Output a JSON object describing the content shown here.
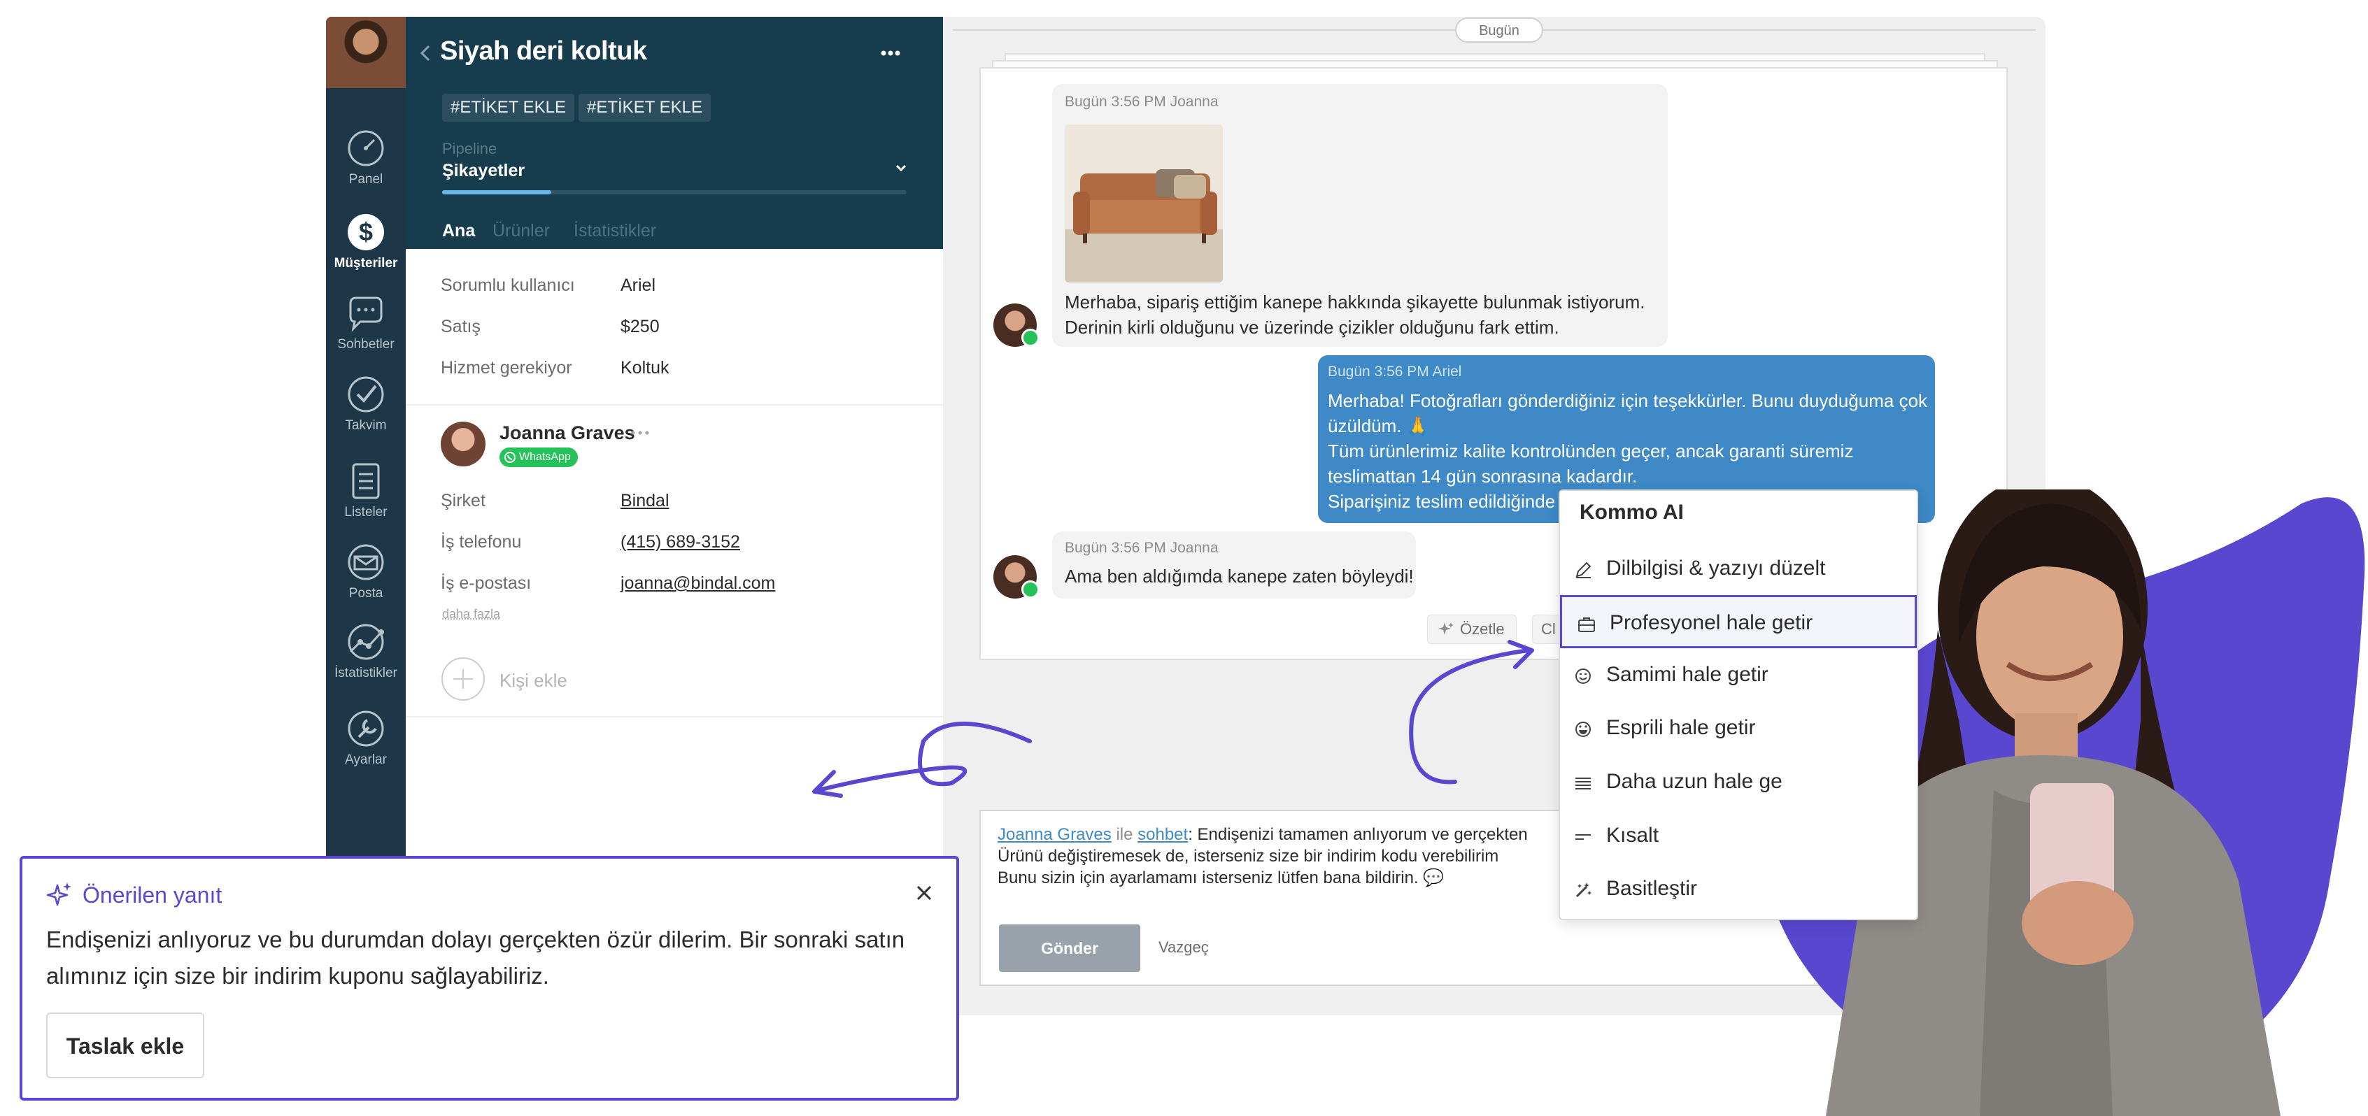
{
  "nav": {
    "items": [
      {
        "label": "Panel",
        "icon": "gauge-icon"
      },
      {
        "label": "Müşteriler",
        "icon": "dollar-icon",
        "active": true
      },
      {
        "label": "Sohbetler",
        "icon": "chat-icon"
      },
      {
        "label": "Takvim",
        "icon": "check-icon"
      },
      {
        "label": "Listeler",
        "icon": "list-icon"
      },
      {
        "label": "Posta",
        "icon": "mail-icon"
      },
      {
        "label": "İstatistikler",
        "icon": "stats-icon"
      },
      {
        "label": "Ayarlar",
        "icon": "wrench-icon"
      }
    ]
  },
  "lead": {
    "title": "Siyah deri koltuk",
    "tags": [
      "#ETİKET EKLE",
      "#ETİKET EKLE"
    ],
    "pipeline_label": "Pipeline",
    "pipeline_value": "Şikayetler",
    "tabs": [
      "Ana",
      "Ürünler",
      "İstatistikler"
    ],
    "fields": [
      {
        "label": "Sorumlu kullanıcı",
        "value": "Ariel"
      },
      {
        "label": "Satış",
        "value": "$250"
      },
      {
        "label": "Hizmet gerekiyor",
        "value": "Koltuk"
      }
    ],
    "contact": {
      "name": "Joanna Graves",
      "channel": "WhatsApp",
      "fields": [
        {
          "label": "Şirket",
          "value": "Bindal"
        },
        {
          "label": "İş telefonu",
          "value": "(415) 689-3152"
        },
        {
          "label": "İş e-postası",
          "value": "joanna@bindal.com"
        }
      ],
      "more": "daha fazla"
    },
    "add_contact": "Kişi ekle"
  },
  "chat": {
    "day": "Bugün",
    "messages": [
      {
        "meta": "Bugün 3:56 PM Joanna",
        "text": "Merhaba, sipariş ettiğim kanepe hakkında şikayette bulunmak istiyorum.\nDerinin kirli olduğunu ve üzerinde çizikler olduğunu fark ettim."
      },
      {
        "meta": "Bugün 3:56 PM Ariel",
        "text": "Merhaba! Fotoğrafları gönderdiğiniz için teşekkürler. Bunu duyduğuma çok\nüzüldüm. 🙏\nTüm ürünlerimiz kalite kontrolünden geçer, ancak garanti süremiz\nteslimattan 14 gün sonrasına kadardır.\nSiparişiniz teslim edildiğinde"
      },
      {
        "meta": "Bugün 3:56 PM Joanna",
        "text": "Ama ben aldığımda kanepe zaten böyleydi!"
      }
    ],
    "summarize": "Özetle",
    "cut_button": "Cl"
  },
  "composer": {
    "to_name": "Joanna Graves",
    "with_word": "ile",
    "channel_word": "sohbet",
    "line1": ": Endişenizi tamamen anlıyorum ve gerçekten",
    "line2": "Ürünü değiştiremesek de, isterseniz size bir indirim kodu verebilirim",
    "line3": "Bunu sizin için ayarlamamı isterseniz lütfen bana bildirin. 💬",
    "send": "Gönder",
    "cancel": "Vazgeç"
  },
  "ai_menu": {
    "title": "Kommo AI",
    "items": [
      {
        "label": "Dilbilgisi & yazıyı düzelt",
        "icon": "pencil-icon"
      },
      {
        "label": "Profesyonel hale getir",
        "icon": "briefcase-icon",
        "selected": true
      },
      {
        "label": "Samimi hale getir",
        "icon": "smile-icon"
      },
      {
        "label": "Esprili hale getir",
        "icon": "laugh-icon"
      },
      {
        "label": "Daha uzun hale ge",
        "icon": "lines-icon"
      },
      {
        "label": "Kısalt",
        "icon": "short-lines-icon"
      },
      {
        "label": "Basitleştir",
        "icon": "magic-icon"
      }
    ]
  },
  "suggestion": {
    "title": "Önerilen yanıt",
    "text_line1": "Endişenizi anlıyoruz ve bu durumdan dolayı gerçekten özür dilerim. Bir sonraki satın",
    "text_line2": "alımınız için size bir indirim kuponu sağlayabiliriz.",
    "button": "Taslak ekle"
  },
  "colors": {
    "nav": "#1d3748",
    "lead_header": "#163c4d",
    "accent": "#5a47d0",
    "outgoing_bubble": "#3e89c6",
    "whatsapp": "#25c25a"
  }
}
